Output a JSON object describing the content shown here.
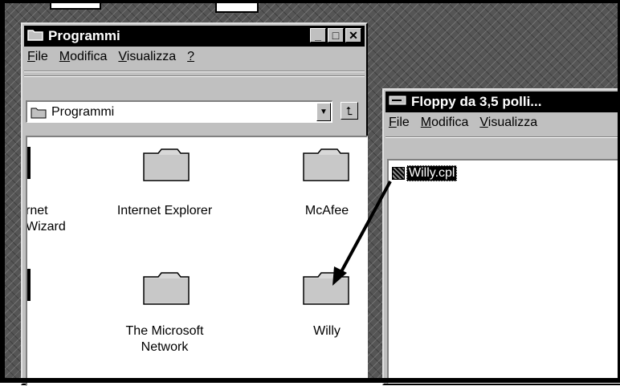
{
  "window_programmi": {
    "title": "Programmi",
    "menu": [
      {
        "label": "File",
        "accel": "F",
        "rest": "ile"
      },
      {
        "label": "Modifica",
        "accel": "M",
        "rest": "odifica"
      },
      {
        "label": "Visualizza",
        "accel": "V",
        "rest": "isualizza"
      },
      {
        "label": "?",
        "accel": "?",
        "rest": ""
      }
    ],
    "address": "Programmi",
    "items": [
      {
        "line1": "rnet",
        "line2": "Wizard"
      },
      {
        "line1": "Internet Explorer",
        "line2": ""
      },
      {
        "line1": "McAfee",
        "line2": ""
      },
      {
        "line1": "The Microsoft",
        "line2": "Network"
      },
      {
        "line1": "Willy",
        "line2": ""
      }
    ],
    "buttons": {
      "minimize": "_",
      "maximize": "□",
      "close": "✕"
    }
  },
  "window_floppy": {
    "title": "Floppy da 3,5 polli...",
    "menu": [
      {
        "label": "File",
        "accel": "F",
        "rest": "ile"
      },
      {
        "label": "Modifica",
        "accel": "M",
        "rest": "odifica"
      },
      {
        "label": "Visualizza",
        "accel": "V",
        "rest": "isualizza"
      }
    ],
    "file": "Willy.cpl"
  },
  "icons": {
    "folder": "folder-icon",
    "drive": "floppy-drive-icon",
    "up": "up-folder-icon",
    "dropdown": "chevron-down-icon",
    "cpl": "control-panel-file-icon"
  },
  "colors": {
    "titlebar": "#000000",
    "window": "#c0c0c0",
    "pane": "#ffffff"
  }
}
